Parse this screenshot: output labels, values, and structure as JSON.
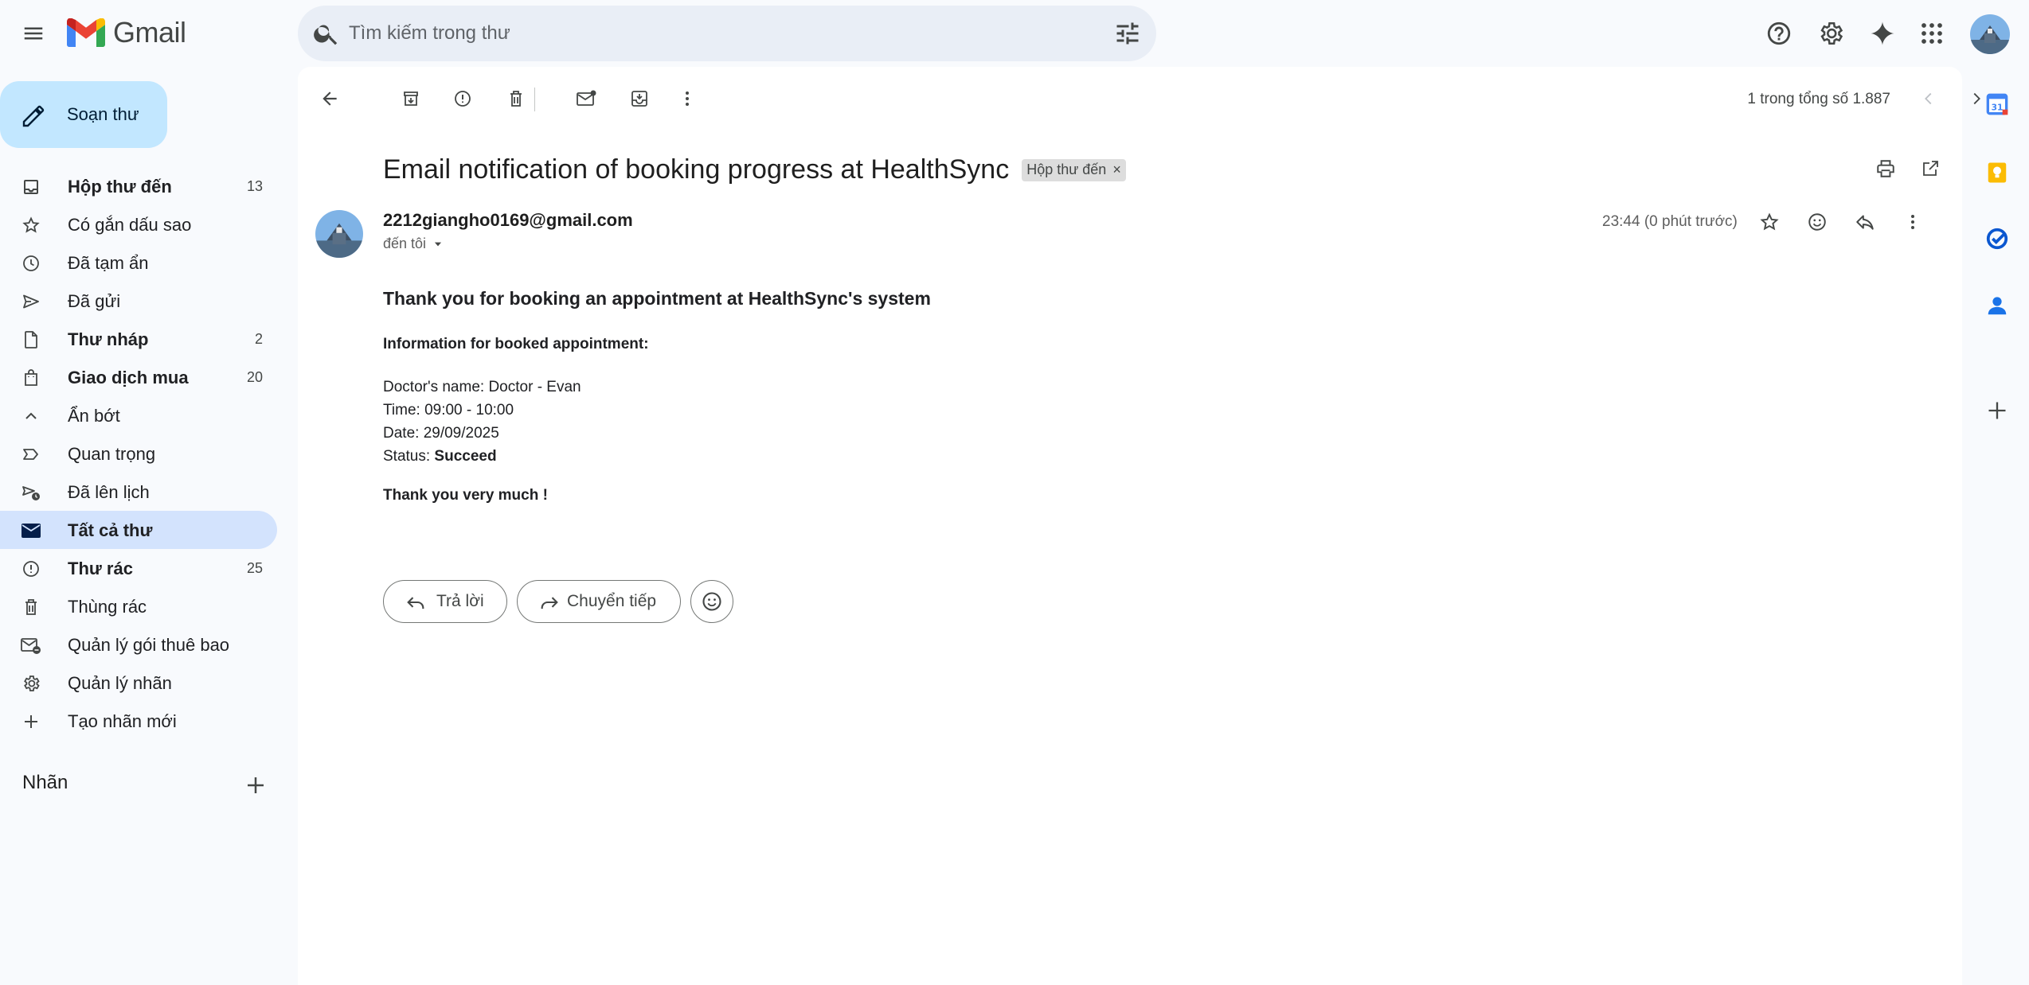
{
  "app": {
    "name": "Gmail"
  },
  "search": {
    "placeholder": "Tìm kiếm trong thư"
  },
  "compose": {
    "label": "Soạn thư"
  },
  "sidebar": {
    "items": [
      {
        "label": "Hộp thư đến",
        "count": "13",
        "icon": "inbox-icon",
        "bold": true,
        "active": false
      },
      {
        "label": "Có gắn dấu sao",
        "count": "",
        "icon": "star-icon",
        "bold": false,
        "active": false
      },
      {
        "label": "Đã tạm ẩn",
        "count": "",
        "icon": "clock-icon",
        "bold": false,
        "active": false
      },
      {
        "label": "Đã gửi",
        "count": "",
        "icon": "send-icon",
        "bold": false,
        "active": false
      },
      {
        "label": "Thư nháp",
        "count": "2",
        "icon": "draft-icon",
        "bold": true,
        "active": false
      },
      {
        "label": "Giao dịch mua",
        "count": "20",
        "icon": "shopping-bag-icon",
        "bold": true,
        "active": false
      },
      {
        "label": "Ẩn bớt",
        "count": "",
        "icon": "chevron-up-icon",
        "bold": false,
        "active": false
      },
      {
        "label": "Quan trọng",
        "count": "",
        "icon": "important-icon",
        "bold": false,
        "active": false
      },
      {
        "label": "Đã lên lịch",
        "count": "",
        "icon": "scheduled-icon",
        "bold": false,
        "active": false
      },
      {
        "label": "Tất cả thư",
        "count": "",
        "icon": "all-mail-icon",
        "bold": true,
        "active": true
      },
      {
        "label": "Thư rác",
        "count": "25",
        "icon": "spam-icon",
        "bold": true,
        "active": false
      },
      {
        "label": "Thùng rác",
        "count": "",
        "icon": "trash-icon",
        "bold": false,
        "active": false
      },
      {
        "label": "Quản lý gói thuê bao",
        "count": "",
        "icon": "subscriptions-icon",
        "bold": false,
        "active": false
      },
      {
        "label": "Quản lý nhãn",
        "count": "",
        "icon": "gear-icon",
        "bold": false,
        "active": false
      },
      {
        "label": "Tạo nhãn mới",
        "count": "",
        "icon": "plus-icon",
        "bold": false,
        "active": false
      }
    ],
    "labels_header": "Nhãn"
  },
  "toolbar": {
    "pager": "1 trong tổng số 1.887"
  },
  "email": {
    "subject": "Email notification of booking progress at HealthSync",
    "badge": "Hộp thư đến",
    "badge_close": "×",
    "sender": "2212giangho0169@gmail.com",
    "to": "đến tôi",
    "timestamp": "23:44 (0 phút trước)",
    "heading": "Thank you for booking an appointment at HealthSync's system",
    "subheading": "Information for booked appointment:",
    "doctor_line": "Doctor's name: Doctor - Evan",
    "time_line": "Time: 09:00 - 10:00",
    "date_line": "Date: 29/09/2025",
    "status_label": "Status: ",
    "status_value": "Succeed",
    "closing": "Thank you very much !"
  },
  "actions": {
    "reply": "Trả lời",
    "forward": "Chuyển tiếp"
  },
  "colors": {
    "accent": "#c2e7ff",
    "active_nav": "#d3e3fd",
    "background": "#f8fafd"
  }
}
